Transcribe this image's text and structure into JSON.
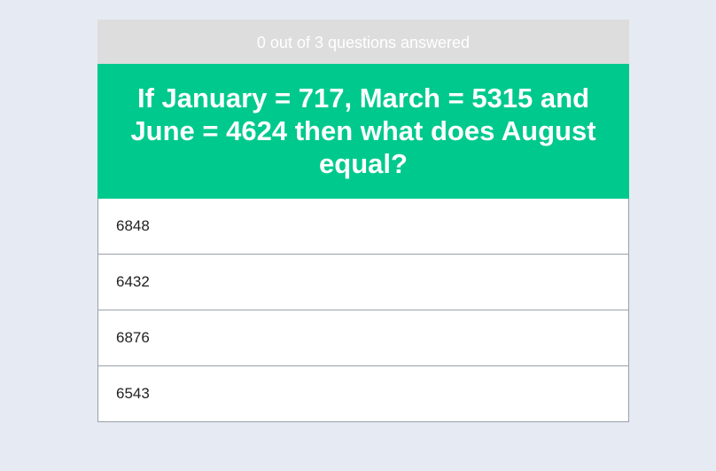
{
  "progress": {
    "text": "0 out of 3 questions answered",
    "answered": 0,
    "total": 3
  },
  "question": {
    "text": "If January = 717, March = 5315 and June = 4624 then what does August equal?"
  },
  "answers": [
    {
      "label": "6848"
    },
    {
      "label": "6432"
    },
    {
      "label": "6876"
    },
    {
      "label": "6543"
    }
  ],
  "colors": {
    "page_background": "#e6eaf2",
    "progress_background": "#dddddd",
    "question_background": "#00c98d",
    "answer_border": "#9aa0aa"
  }
}
